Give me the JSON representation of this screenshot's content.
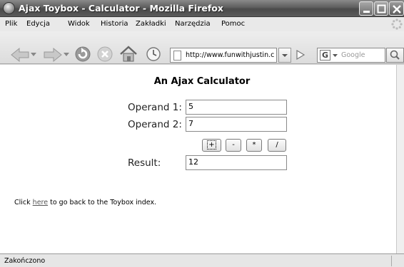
{
  "window": {
    "title": "Ajax Toybox - Calculator - Mozilla Firefox"
  },
  "menu": {
    "items": [
      "Plik",
      "Edycja",
      "Widok",
      "Historia",
      "Zakładki",
      "Narzędzia",
      "Pomoc"
    ]
  },
  "toolbar": {
    "url": "http://www.funwithjustin.c",
    "search_engine_icon": "G",
    "search_placeholder": "Google",
    "icons": [
      "back-arrow-icon",
      "forward-arrow-icon",
      "reload-icon",
      "stop-icon",
      "home-icon",
      "history-clock-icon"
    ]
  },
  "page": {
    "title": "An Ajax Calculator",
    "operand1_label": "Operand 1:",
    "operand1_value": "5",
    "operand2_label": "Operand 2:",
    "operand2_value": "7",
    "buttons": {
      "add": "+",
      "subtract": "-",
      "multiply": "*",
      "divide": "/"
    },
    "result_label": "Result:",
    "result_value": "12",
    "footer_prefix": "Click ",
    "footer_link": "here",
    "footer_suffix": " to go back to the Toybox index."
  },
  "status": {
    "text": "Zakończono"
  }
}
